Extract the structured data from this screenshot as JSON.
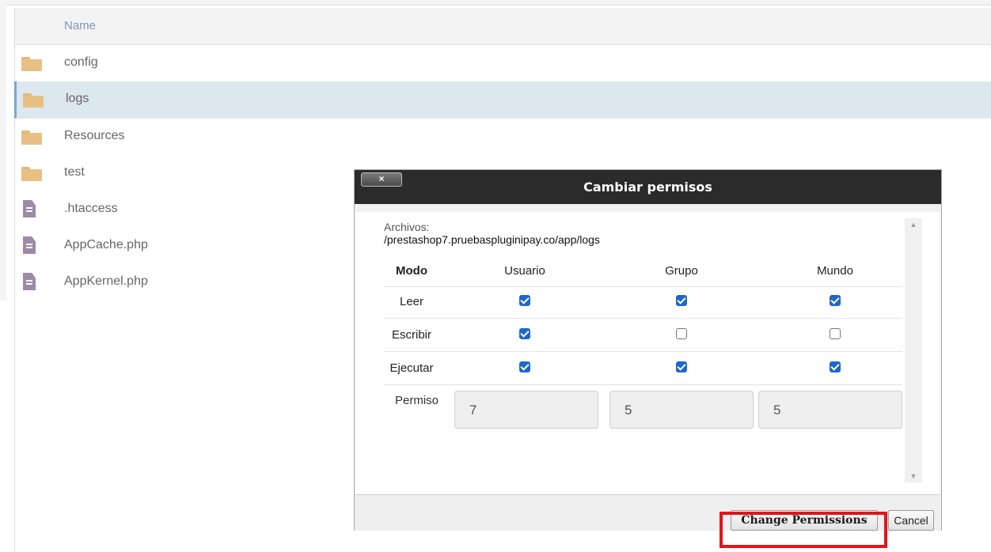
{
  "file_manager": {
    "header": {
      "name_col": "Name"
    },
    "rows": [
      {
        "label": "config",
        "type": "folder"
      },
      {
        "label": "logs",
        "type": "folder",
        "selected": true
      },
      {
        "label": "Resources",
        "type": "folder"
      },
      {
        "label": "test",
        "type": "folder"
      },
      {
        "label": ".htaccess",
        "type": "file"
      },
      {
        "label": "AppCache.php",
        "type": "file"
      },
      {
        "label": "AppKernel.php",
        "type": "file"
      }
    ]
  },
  "dialog": {
    "title": "Cambiar permisos",
    "close_label": "×",
    "files_label": "Archivos:",
    "path": "/prestashop7.pruebaspluginipay.co/app/logs",
    "columns": {
      "mode": "Modo",
      "user": "Usuario",
      "group": "Grupo",
      "world": "Mundo"
    },
    "permissions": [
      {
        "label": "Leer",
        "user": true,
        "group": true,
        "world": true
      },
      {
        "label": "Escribir",
        "user": true,
        "group": false,
        "world": false
      },
      {
        "label": "Ejecutar",
        "user": true,
        "group": true,
        "world": true
      }
    ],
    "permiso_label": "Permiso",
    "permiso_values": {
      "user": "7",
      "group": "5",
      "world": "5"
    },
    "buttons": {
      "change": "Change Permissions",
      "cancel": "Cancel"
    }
  },
  "colors": {
    "highlight": "#e3141b",
    "checkbox_on": "#1f67c9",
    "titlebar": "#2b2b2b"
  }
}
